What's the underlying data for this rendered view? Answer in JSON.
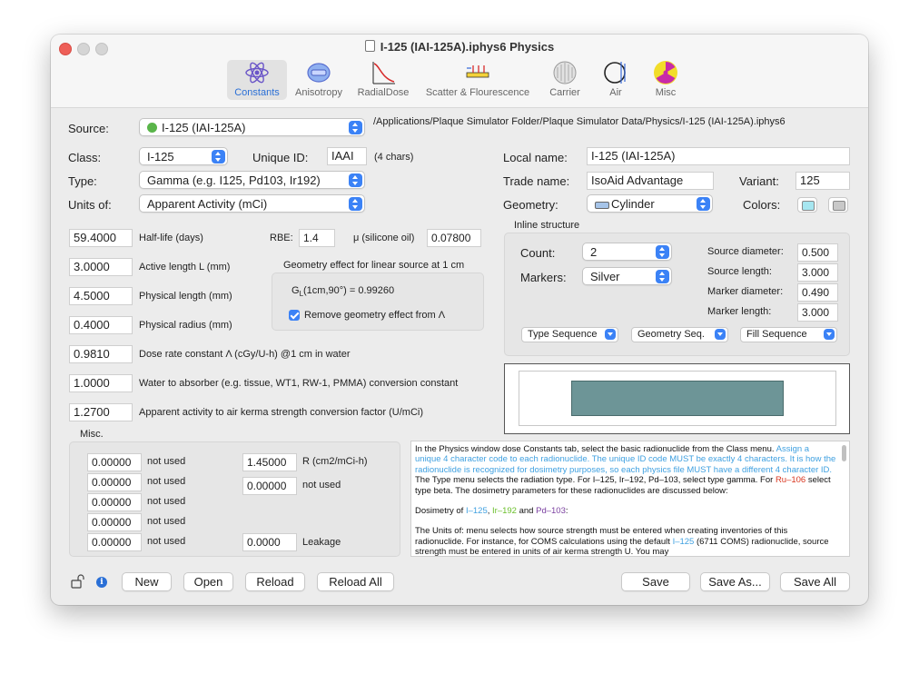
{
  "window": {
    "title": "I-125 (IAI-125A).iphys6 Physics"
  },
  "toolbar": {
    "items": [
      {
        "label": "Constants",
        "icon": "atom-icon"
      },
      {
        "label": "Anisotropy",
        "icon": "anisotropy-icon"
      },
      {
        "label": "RadialDose",
        "icon": "radial-dose-icon"
      },
      {
        "label": "Scatter & Flourescence",
        "icon": "scatter-icon"
      },
      {
        "label": "Carrier",
        "icon": "carrier-icon"
      },
      {
        "label": "Air",
        "icon": "air-icon"
      },
      {
        "label": "Misc",
        "icon": "radiation-icon"
      }
    ]
  },
  "source": {
    "label": "Source:",
    "value": "I-125 (IAI-125A)",
    "path": "/Applications/Plaque Simulator Folder/Plaque Simulator Data/Physics/I-125 (IAI-125A).iphys6"
  },
  "class": {
    "label": "Class:",
    "value": "I-125"
  },
  "unique_id": {
    "label": "Unique ID:",
    "value": "IAAI",
    "hint": "(4 chars)"
  },
  "type": {
    "label": "Type:",
    "value": "Gamma (e.g. I125, Pd103, Ir192)"
  },
  "units": {
    "label": "Units of:",
    "value": "Apparent Activity (mCi)"
  },
  "local_name": {
    "label": "Local name:",
    "value": "I-125 (IAI-125A)"
  },
  "trade_name": {
    "label": "Trade name:",
    "value": "IsoAid Advantage"
  },
  "variant": {
    "label": "Variant:",
    "value": "125"
  },
  "geometry": {
    "label": "Geometry:",
    "value": "Cylinder"
  },
  "colors": {
    "label": "Colors:",
    "color1": "#a6e6f0",
    "color2": "#c8c8c8"
  },
  "params": {
    "half_life": {
      "value": "59.4000",
      "label": "Half-life (days)"
    },
    "active_length": {
      "value": "3.0000",
      "label": "Active length L (mm)"
    },
    "physical_length": {
      "value": "4.5000",
      "label": "Physical length (mm)"
    },
    "physical_radius": {
      "value": "0.4000",
      "label": "Physical radius (mm)"
    },
    "dose_rate": {
      "value": "0.9810",
      "label": "Dose rate constant Λ (cGy/U-h) @1 cm in water"
    },
    "water_absorber": {
      "value": "1.0000",
      "label": "Water to absorber (e.g. tissue, WT1, RW-1, PMMA) conversion constant"
    },
    "apparent_activity": {
      "value": "1.2700",
      "label": "Apparent activity to air kerma strength conversion factor (U/mCi)"
    }
  },
  "rbe": {
    "label": "RBE:",
    "value": "1.4"
  },
  "mu": {
    "label": "μ (silicone oil)",
    "value": "0.07800"
  },
  "geometry_effect": {
    "title": "Geometry effect for linear source at 1 cm",
    "formula": "G",
    "formula_sub": "L",
    "formula_rest": "(1cm,90°) =  0.99260",
    "checkbox_label": "Remove geometry effect from Λ",
    "checked": true
  },
  "inline": {
    "title": "Inline structure",
    "count": {
      "label": "Count:",
      "value": "2"
    },
    "markers": {
      "label": "Markers:",
      "value": "Silver"
    },
    "source_diameter": {
      "label": "Source diameter:",
      "value": "0.500"
    },
    "source_length": {
      "label": "Source length:",
      "value": "3.000"
    },
    "marker_diameter": {
      "label": "Marker diameter:",
      "value": "0.490"
    },
    "marker_length": {
      "label": "Marker length:",
      "value": "3.000"
    },
    "type_seq": "Type Sequence",
    "geometry_seq": "Geometry Seq.",
    "fill_seq": "Fill Sequence"
  },
  "preview": {
    "fill": "#6d9597"
  },
  "misc": {
    "title": "Misc.",
    "left": [
      {
        "value": "0.00000",
        "label": "not used"
      },
      {
        "value": "0.00000",
        "label": "not used"
      },
      {
        "value": "0.00000",
        "label": "not used"
      },
      {
        "value": "0.00000",
        "label": "not used"
      },
      {
        "value": "0.00000",
        "label": "not used"
      }
    ],
    "right": [
      {
        "value": "1.45000",
        "label": "R (cm2/mCi-h)"
      },
      {
        "value": "0.00000",
        "label": "not used"
      },
      {
        "value": "0.0000",
        "label": "Leakage"
      }
    ]
  },
  "help": {
    "p1a": "In the Physics window dose Constants tab, select the basic radionuclide from the Class menu.",
    "p1b": "Assign a unique 4 character code to each radionuclide. The unique ID code MUST be exactly 4 characters. It is how the radionuclide is recognized for dosimetry purposes, so each physics file MUST have a different 4 character ID.",
    "p1c": " The Type menu selects the radiation type. For I–125, Ir–192, Pd–103, select type gamma. For ",
    "p1d": "Ru–106",
    "p1e": " select type beta. The dosimetry parameters for these radionuclides are discussed below:",
    "p2a": "Dosimetry of ",
    "p2b": "I–125",
    "p2c": ", ",
    "p2d": "Ir–192",
    "p2e": " and ",
    "p2f": "Pd–103",
    "p2g": ":",
    "p3a": "The Units of: menu selects how source strength must be entered when creating inventories of this radionuclide.  For instance, for COMS calculations using the default ",
    "p3b": "I–125",
    "p3c": " (6711 COMS) radionuclide, source strength must be entered in units of air kerma strength U. You may"
  },
  "bottom": {
    "new": "New",
    "open": "Open",
    "reload": "Reload",
    "reload_all": "Reload All",
    "save": "Save",
    "save_as": "Save As...",
    "save_all": "Save All"
  }
}
